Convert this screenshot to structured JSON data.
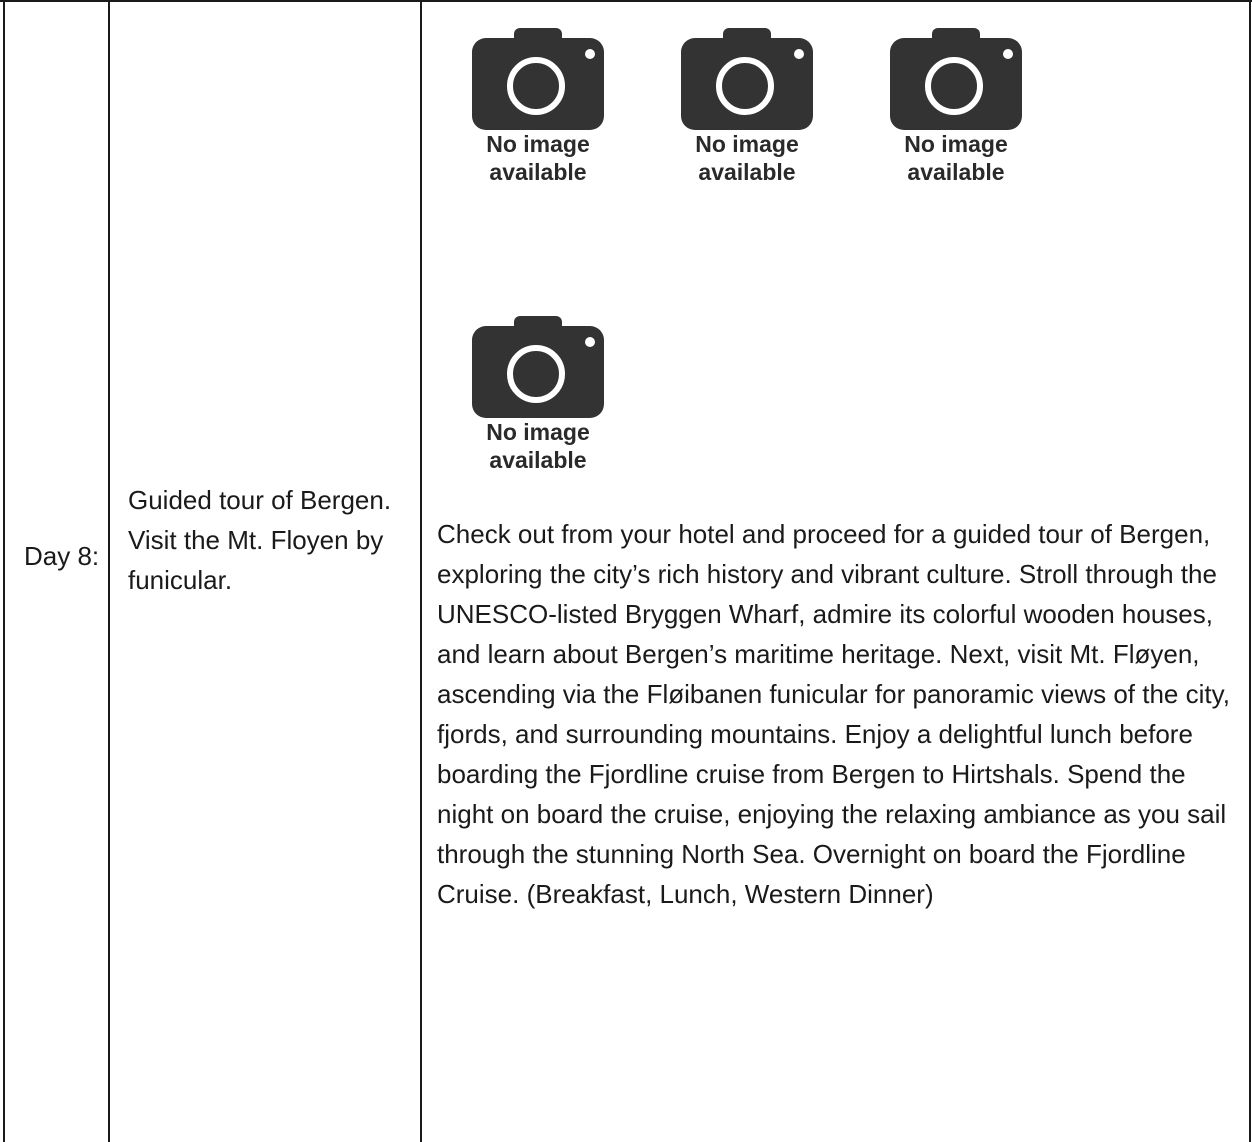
{
  "row": {
    "day": "Day 8:",
    "summary": "Guided tour of Bergen. Visit the Mt. Floyen by funicular.",
    "description": "Check out from your hotel and proceed for a guided tour of Bergen, exploring the city’s rich history and vibrant culture. Stroll through the UNESCO-listed Bryggen Wharf, admire its colorful wooden houses, and learn about Bergen’s maritime heritage. Next, visit Mt. Fløyen, ascending via the Fløibanen funicular for panoramic views of the city, fjords, and surrounding mountains. Enjoy a delightful lunch before boarding the Fjordline cruise from Bergen to Hirtshals. Spend the night on board the cruise, enjoying the relaxing ambiance as you sail through the stunning North Sea. Overnight on board the Fjordline Cruise. (Breakfast, Lunch, Western Dinner)"
  },
  "photos": [
    {
      "caption": "No image available",
      "icon": "camera-icon"
    },
    {
      "caption": "No image available",
      "icon": "camera-icon"
    },
    {
      "caption": "No image available",
      "icon": "camera-icon"
    },
    {
      "caption": "No image available",
      "icon": "camera-icon"
    }
  ],
  "colors": {
    "border": "#1a1a1a",
    "camera": "#333333",
    "text": "#1a1a1a"
  }
}
